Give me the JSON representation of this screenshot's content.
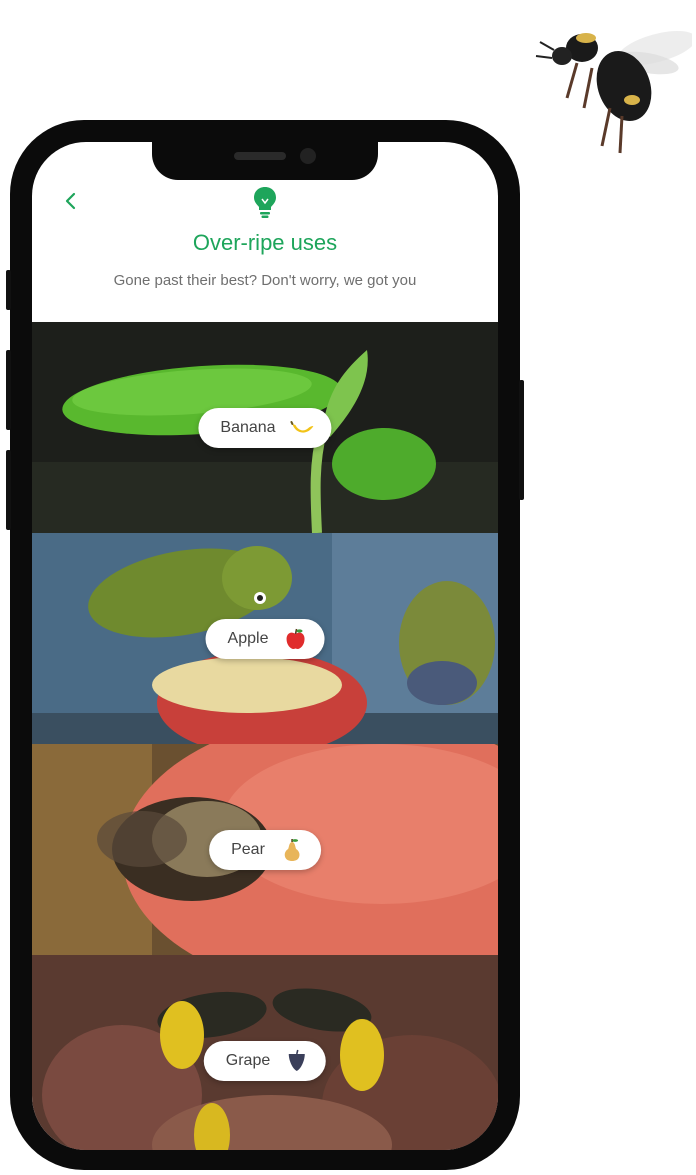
{
  "header": {
    "title": "Over-ripe uses",
    "subtitle": "Gone past their best? Don't worry, we got you",
    "back_icon": "chevron-left-icon",
    "brand_icon": "lightbulb-icon"
  },
  "categories": [
    {
      "label": "Banana",
      "icon": "banana-icon"
    },
    {
      "label": "Apple",
      "icon": "apple-icon"
    },
    {
      "label": "Pear",
      "icon": "pear-icon"
    },
    {
      "label": "Grape",
      "icon": "grape-icon"
    }
  ],
  "colors": {
    "accent": "#1ea55b",
    "subtitle": "#6f6f6f",
    "phone_frame": "#0b0b0b"
  }
}
